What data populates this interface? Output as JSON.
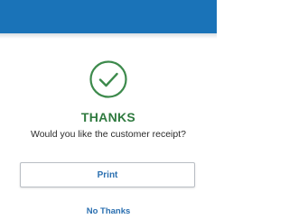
{
  "colors": {
    "header": "#1a73b8",
    "success": "#2f7a3f",
    "link": "#2a6fb0"
  },
  "status": {
    "icon": "check-circle-icon",
    "title": "THANKS",
    "question": "Would you like the customer receipt?"
  },
  "actions": {
    "print_label": "Print",
    "no_thanks_label": "No Thanks"
  }
}
